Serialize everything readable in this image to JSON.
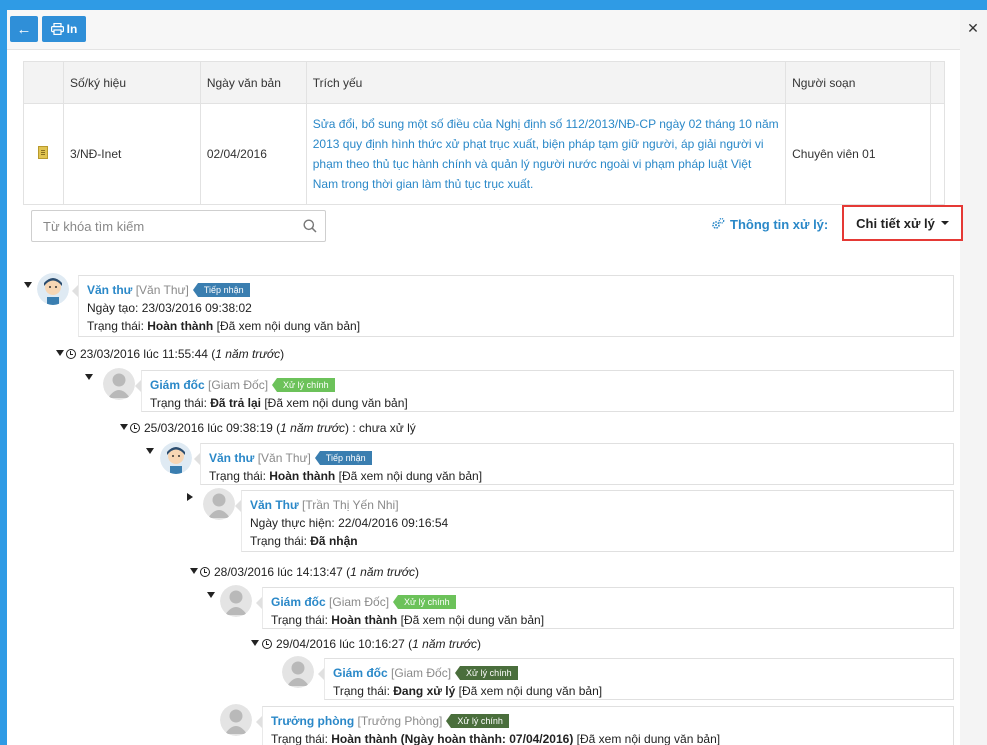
{
  "toolbar": {
    "back_icon": "arrow-left-icon",
    "print_label": "In",
    "print_icon": "printer-icon",
    "close_icon": "close-icon"
  },
  "doc_table": {
    "headers": [
      "Số/ký hiệu",
      "Ngày văn bản",
      "Trích yếu",
      "Người soạn"
    ],
    "row": {
      "icon": "document-icon",
      "number": "3/NĐ-Inet",
      "date": "02/04/2016",
      "summary": "Sửa đổi, bổ sung một số điều của Nghị định số 112/2013/NĐ-CP ngày 02 tháng 10 năm 2013 quy định hình thức xử phạt trục xuất, biện pháp tạm giữ người, áp giải người vi phạm theo thủ tục hành chính và quản lý người nước ngoài vi phạm pháp luật Việt Nam trong thời gian làm thủ tục trục xuất.",
      "author": "Chuyên viên 01"
    }
  },
  "search": {
    "placeholder": "Từ khóa tìm kiếm",
    "icon": "search-icon"
  },
  "processing": {
    "label": "Thông tin xử lý:",
    "icon": "gears-icon",
    "dropdown_value": "Chi tiết xử lý"
  },
  "labels": {
    "created": "Ngày tạo:",
    "status": "Trạng thái:",
    "done_at": "Ngày thực hiện:",
    "at": "lúc"
  },
  "tree": {
    "n1": {
      "name": "Văn thư",
      "role": "[Văn Thư]",
      "badge": "Tiếp nhận",
      "created": "23/03/2016 09:38:02",
      "status_bold": "Hoàn thành",
      "status_rest": "[Đã xem nội dung văn bản]"
    },
    "t1": {
      "date": "23/03/2016",
      "time": "11:55:44",
      "ago": "1 năm trước"
    },
    "n2": {
      "name": "Giám đốc",
      "role": "[Giam Đốc]",
      "badge": "Xử lý chính",
      "status_bold": "Đã trả lại",
      "status_rest": "[Đã xem nội dung văn bản]"
    },
    "t2": {
      "date": "25/03/2016",
      "time": "09:38:19",
      "ago": "1 năm trước",
      "suffix": ": chưa xử lý"
    },
    "n3": {
      "name": "Văn thư",
      "role": "[Văn Thư]",
      "badge": "Tiếp nhận",
      "status_bold": "Hoàn thành",
      "status_rest": "[Đã xem nội dung văn bản]"
    },
    "n4": {
      "name": "Văn Thư",
      "role": "[Trần Thị Yến Nhi]",
      "done_at": "22/04/2016 09:16:54",
      "status_bold": "Đã nhận"
    },
    "t3": {
      "date": "28/03/2016",
      "time": "14:13:47",
      "ago": "1 năm trước"
    },
    "n5": {
      "name": "Giám đốc",
      "role": "[Giam Đốc]",
      "badge": "Xử lý chính",
      "status_bold": "Hoàn thành",
      "status_rest": "[Đã xem nội dung văn bản]"
    },
    "t4": {
      "date": "29/04/2016",
      "time": "10:16:27",
      "ago": "1 năm trước"
    },
    "n6": {
      "name": "Giám đốc",
      "role": "[Giam Đốc]",
      "badge": "Xử lý chính",
      "status_bold": "Đang xử lý",
      "status_rest": "[Đã xem nội dung văn bản]"
    },
    "n7": {
      "name": "Trưởng phòng",
      "role": "[Trưởng Phòng]",
      "badge": "Xử lý chính",
      "status_bold": "Hoàn thành (Ngày hoàn thành: 07/04/2016)",
      "status_rest": "[Đã xem nội dung văn bản]"
    }
  },
  "colors": {
    "accent": "#2f8fd8",
    "link": "#2a88c8",
    "highlight_border": "#e53935",
    "badge_tiepnhan": "#3a7eb0",
    "badge_xlc_light": "#6cc25a",
    "badge_xlc_dark": "#4a6e3c"
  }
}
